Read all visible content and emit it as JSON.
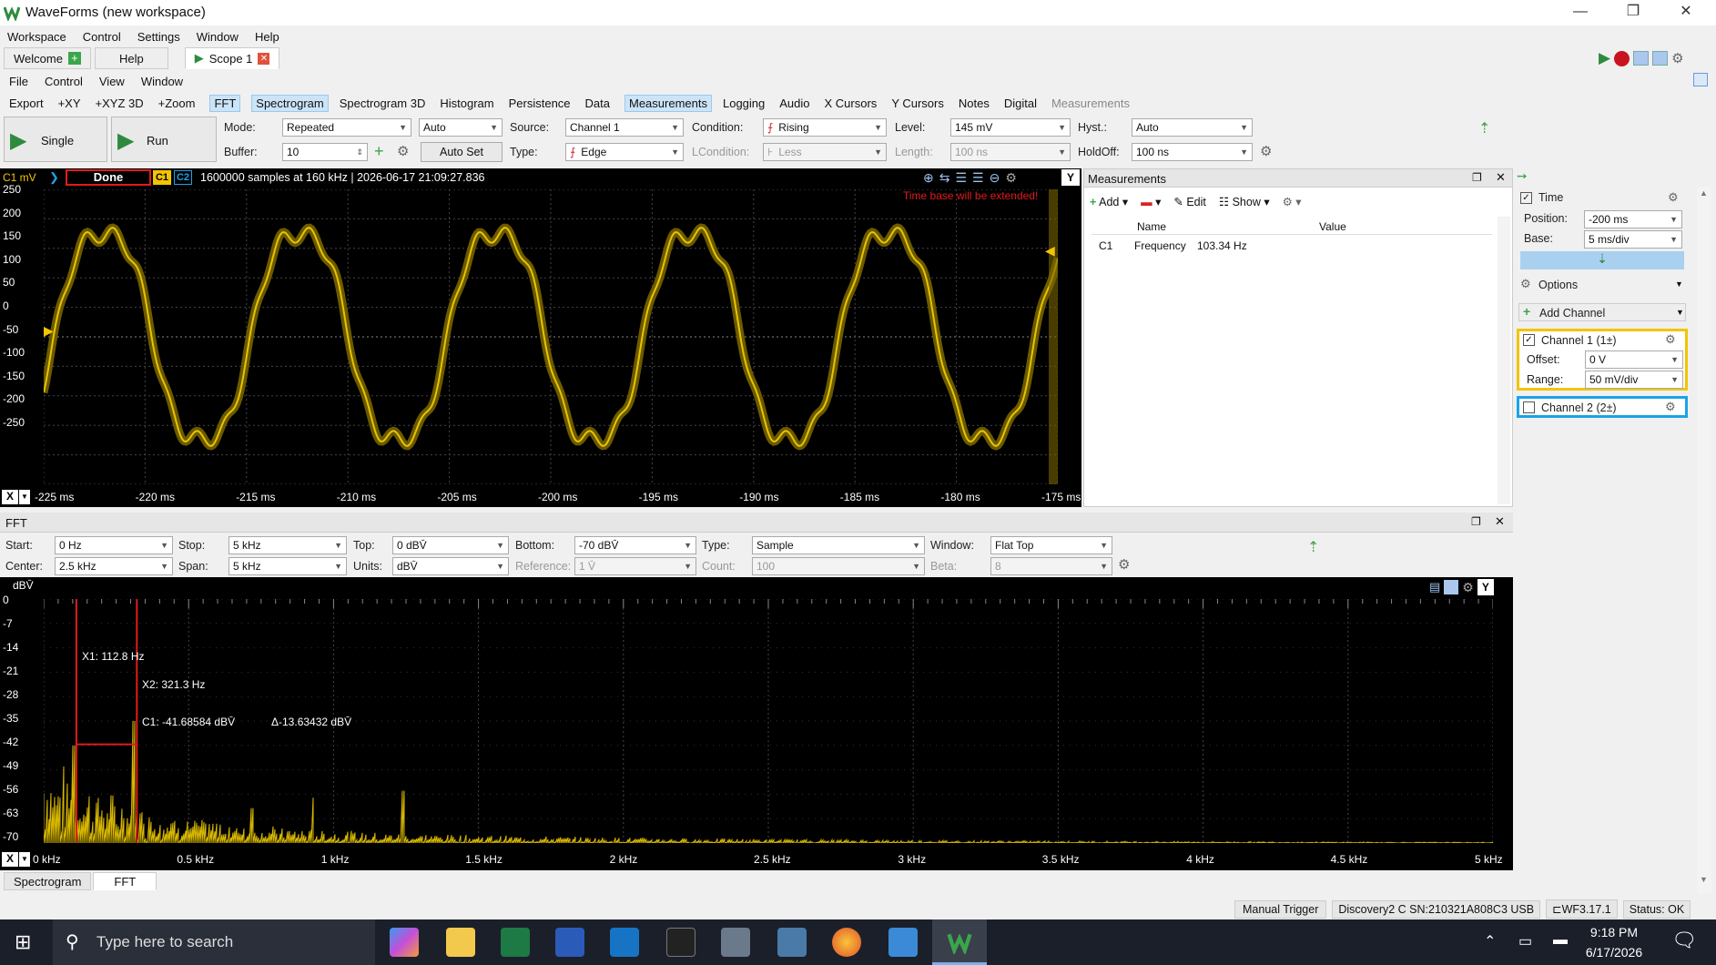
{
  "window": {
    "title": "WaveForms (new workspace)",
    "min": "—",
    "restore": "❐",
    "close": "✕"
  },
  "app_menu": [
    "Workspace",
    "Control",
    "Settings",
    "Window",
    "Help"
  ],
  "doc_tabs": [
    {
      "label": "Welcome"
    },
    {
      "label": "Help"
    },
    {
      "label": "Scope 1"
    }
  ],
  "scope_menu": [
    "File",
    "Control",
    "View",
    "Window"
  ],
  "instruments": [
    {
      "label": "Export"
    },
    {
      "label": "+XY"
    },
    {
      "label": "+XYZ 3D"
    },
    {
      "label": "+Zoom"
    },
    {
      "label": "FFT",
      "hl": true
    },
    {
      "label": "Spectrogram",
      "hl": true
    },
    {
      "label": "Spectrogram 3D"
    },
    {
      "label": "Histogram"
    },
    {
      "label": "Persistence"
    },
    {
      "label": "Data"
    },
    {
      "label": "Measurements",
      "hl": true
    },
    {
      "label": "Logging"
    },
    {
      "label": "Audio"
    },
    {
      "label": "X Cursors"
    },
    {
      "label": "Y Cursors"
    },
    {
      "label": "Notes"
    },
    {
      "label": "Digital"
    },
    {
      "label": "Measurements",
      "dim": true
    }
  ],
  "acq": {
    "single": "Single",
    "run": "Run",
    "mode_label": "Mode:",
    "mode": "Repeated",
    "mode2": "Auto",
    "buffer_label": "Buffer:",
    "buffer": "10",
    "autoset": "Auto Set",
    "source_label": "Source:",
    "source": "Channel 1",
    "type_label": "Type:",
    "type": "Edge",
    "condition_label": "Condition:",
    "condition": "Rising",
    "lcondition_label": "LCondition:",
    "lcondition": "Less",
    "level_label": "Level:",
    "level": "145 mV",
    "length_label": "Length:",
    "length": "100 ns",
    "hyst_label": "Hyst.:",
    "hyst": "Auto",
    "holdoff_label": "HoldOff:",
    "holdoff": "100 ns"
  },
  "scope": {
    "ch_unit": "C1 mV",
    "status": "Done",
    "c1": "C1",
    "c2": "C2",
    "info": "1600000 samples at 160 kHz | 2026-06-17 21:09:27.836",
    "warning": "Time base will be extended!",
    "y_ticks": [
      "250",
      "200",
      "150",
      "100",
      "50",
      "0",
      "-50",
      "-100",
      "-150",
      "-200",
      "-250"
    ],
    "x_ticks": [
      "-225 ms",
      "-220 ms",
      "-215 ms",
      "-210 ms",
      "-205 ms",
      "-200 ms",
      "-195 ms",
      "-190 ms",
      "-185 ms",
      "-180 ms",
      "-175 ms"
    ],
    "x_btn": "X",
    "y_btn": "Y",
    "trace_color": "#e8c400"
  },
  "measurements": {
    "title": "Measurements",
    "add": "Add",
    "edit": "Edit",
    "show": "Show",
    "col_name": "Name",
    "col_value": "Value",
    "rows": [
      {
        "ch": "C1",
        "name": "Frequency",
        "value": "103.34 Hz"
      }
    ]
  },
  "side": {
    "time": "Time",
    "position_label": "Position:",
    "position": "-200 ms",
    "base_label": "Base:",
    "base": "5 ms/div",
    "options": "Options",
    "add_channel": "Add Channel",
    "ch1": "Channel 1 (1±)",
    "offset_label": "Offset:",
    "offset": "0 V",
    "range_label": "Range:",
    "range": "50 mV/div",
    "ch2": "Channel 2 (2±)",
    "ch1_color": "#f2c500",
    "ch2_color": "#1aa3e8"
  },
  "fft": {
    "title": "FFT",
    "start_label": "Start:",
    "start": "0 Hz",
    "stop_label": "Stop:",
    "stop": "5 kHz",
    "top_label": "Top:",
    "top": "0 dBV̄",
    "bottom_label": "Bottom:",
    "bottom": "-70 dBV̄",
    "type_label": "Type:",
    "type": "Sample",
    "window_label": "Window:",
    "window": "Flat Top",
    "center_label": "Center:",
    "center": "2.5 kHz",
    "span_label": "Span:",
    "span": "5 kHz",
    "units_label": "Units:",
    "units": "dBV̄",
    "reference_label": "Reference:",
    "reference": "1 V̄",
    "count_label": "Count:",
    "count": "100",
    "beta_label": "Beta:",
    "beta": "8",
    "y_unit": "dBV̄",
    "y_ticks": [
      "0",
      "-7",
      "-14",
      "-21",
      "-28",
      "-35",
      "-42",
      "-49",
      "-56",
      "-63",
      "-70"
    ],
    "x_ticks": [
      "0 kHz",
      "0.5 kHz",
      "1 kHz",
      "1.5 kHz",
      "2 kHz",
      "2.5 kHz",
      "3 kHz",
      "3.5 kHz",
      "4 kHz",
      "4.5 kHz",
      "5 kHz"
    ],
    "cursor_x1": "X1: 112.8 Hz",
    "cursor_x2": "X2: 321.3 Hz",
    "cursor_c1": "C1: -41.68584 dBV̄",
    "cursor_delta": "Δ-13.63432 dBV̄",
    "bottom_tabs": [
      "Spectrogram",
      "FFT"
    ]
  },
  "status": {
    "manual_trigger": "Manual Trigger",
    "device": "Discovery2 C SN:210321A808C3 USB",
    "version": "WF3.17.1",
    "state": "Status: OK"
  },
  "taskbar": {
    "search": "Type here to search",
    "time": "9:18 PM",
    "date": "6/17/2026"
  }
}
